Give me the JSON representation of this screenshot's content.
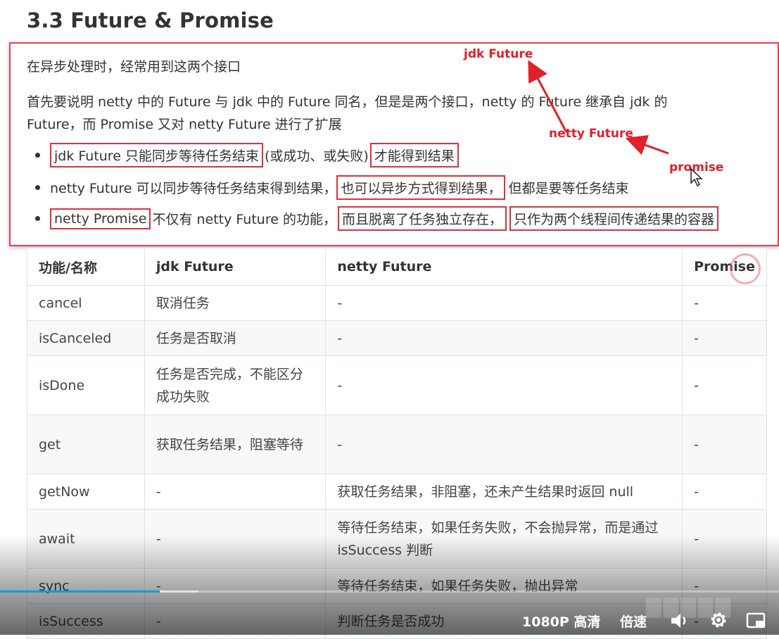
{
  "section_title": "3.3 Future & Promise",
  "intro": "在异步处理时，经常用到这两个接口",
  "para1_line1": "首先要说明 netty 中的 Future 与 jdk 中的 Future 同名，但是是两个接口，netty 的 Future 继承自 jdk 的",
  "para1_line2": "Future，而 Promise 又对 netty Future 进行了扩展",
  "bullets": {
    "b1_box1": "jdk Future 只能同步等待任务结束",
    "b1_mid": "(或成功、或失败)",
    "b1_box2": "才能得到结果",
    "b2_pre": "netty Future 可以同步等待任务结束得到结果，",
    "b2_box": "也可以异步方式得到结果，",
    "b2_post": "但都是要等任务结束",
    "b3_box1": "netty Promise",
    "b3_mid": "不仅有 netty Future 的功能，",
    "b3_box2": "而且脱离了任务独立存在，",
    "b3_box3": "只作为两个线程间传递结果的容器"
  },
  "annotations": {
    "jdk": "jdk Future",
    "netty": "netty Future",
    "promise": "promise"
  },
  "table": {
    "headers": [
      "功能/名称",
      "jdk Future",
      "netty Future",
      "Promise"
    ],
    "rows": [
      [
        "cancel",
        "取消任务",
        "-",
        "-"
      ],
      [
        "isCanceled",
        "任务是否取消",
        "-",
        "-"
      ],
      [
        "isDone",
        "任务是否完成，不能区分成功失败",
        "-",
        "-"
      ],
      [
        "get",
        "获取任务结果，阻塞等待",
        "-",
        "-"
      ],
      [
        "getNow",
        "-",
        "获取任务结果，非阻塞，还未产生结果时返回 null",
        "-"
      ],
      [
        "await",
        "-",
        "等待任务结束，如果任务失败，不会抛异常，而是通过 isSuccess 判断",
        "-"
      ],
      [
        "sync",
        "-",
        "等待任务结束，如果任务失败，抛出异常",
        "-"
      ],
      [
        "isSuccess",
        "-",
        "判断任务是否成功",
        "-"
      ]
    ]
  },
  "player": {
    "quality": "1080P 高清",
    "speed": "倍速",
    "volume_icon": "speaker-icon",
    "settings_icon": "gear-icon",
    "pip_icon": "pip-icon",
    "progress": 0.205,
    "buffered": 0.255,
    "accent": "#00a1d6"
  }
}
